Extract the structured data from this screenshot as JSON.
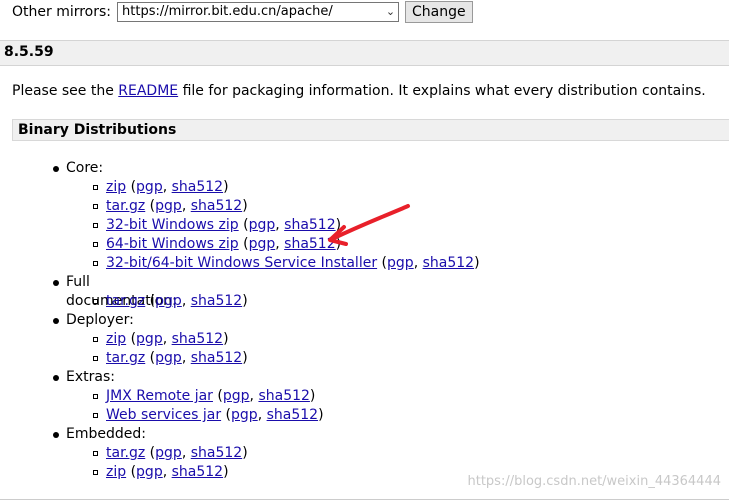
{
  "mirrors": {
    "label": "Other mirrors:",
    "selected": "https://mirror.bit.edu.cn/apache/",
    "change_label": "Change"
  },
  "version": "8.5.59",
  "intro": {
    "before": "Please see the ",
    "readme": "README",
    "after": " file for packaging information. It explains what every distribution contains."
  },
  "section_title": "Binary Distributions",
  "categories": {
    "core": "Core:",
    "fulldoc": "Full documentation:",
    "deployer": "Deployer:",
    "extras": "Extras:",
    "embedded": "Embedded:"
  },
  "links": {
    "core_zip": "zip",
    "core_targz": "tar.gz",
    "core_win32": "32-bit Windows zip",
    "core_win64": "64-bit Windows zip",
    "core_installer": "32-bit/64-bit Windows Service Installer",
    "fulldoc_targz": "tar.gz",
    "deployer_zip": "zip",
    "deployer_targz": "tar.gz",
    "extras_jmx": "JMX Remote jar",
    "extras_ws": "Web services jar",
    "embedded_targz": "tar.gz",
    "embedded_zip": "zip",
    "pgp": "pgp",
    "sha512": "sha512"
  },
  "watermark": "https://blog.csdn.net/weixin_44364444",
  "colors": {
    "link": "#1a0dab",
    "annotation": "#e8202a"
  }
}
